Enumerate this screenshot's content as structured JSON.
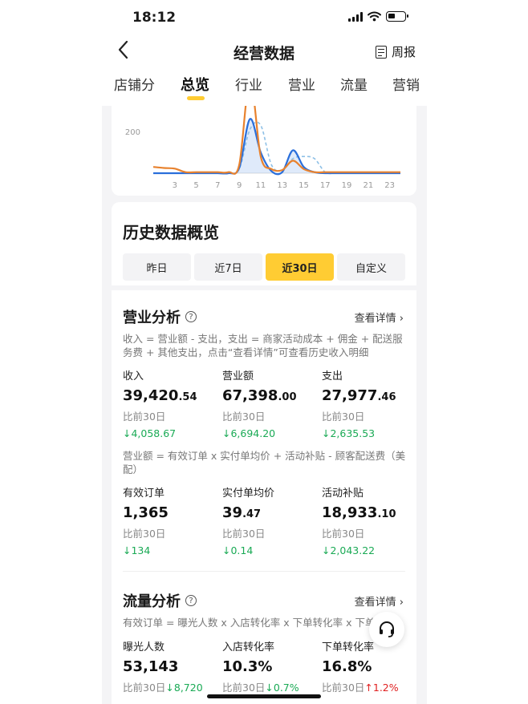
{
  "status": {
    "time": "18:12"
  },
  "nav": {
    "title": "经营数据",
    "weekly": "周报"
  },
  "tabs": [
    "店铺分",
    "总览",
    "行业",
    "营业",
    "流量",
    "营销"
  ],
  "colors": {
    "accent": "#ffcc33",
    "up": "#1aaa55",
    "down": "#e02020",
    "line_orange": "#e8822e",
    "line_blue": "#2a6fdb"
  },
  "chart_data": {
    "type": "line",
    "x_ticks": [
      "3",
      "5",
      "7",
      "9",
      "11",
      "13",
      "15",
      "17",
      "19",
      "21",
      "23"
    ],
    "y_tick": "200",
    "series": [
      {
        "values": [
          30,
          25,
          22,
          5,
          5,
          5,
          5,
          5,
          40,
          450,
          80,
          20,
          15,
          60,
          20,
          5,
          5,
          5,
          5,
          5,
          5,
          5,
          5,
          5
        ]
      },
      {
        "values": [
          0,
          0,
          0,
          0,
          0,
          0,
          0,
          0,
          25,
          260,
          100,
          10,
          5,
          110,
          30,
          5,
          0,
          0,
          0,
          0,
          0,
          0,
          0,
          0
        ]
      },
      {
        "values": [
          0,
          0,
          0,
          0,
          0,
          0,
          0,
          0,
          20,
          210,
          230,
          40,
          15,
          70,
          80,
          70,
          5,
          0,
          0,
          0,
          0,
          0,
          0,
          0
        ]
      }
    ]
  },
  "history": {
    "title": "历史数据概览",
    "ranges": [
      "昨日",
      "近7日",
      "近30日",
      "自定义"
    ],
    "business": {
      "title": "营业分析",
      "help": "?",
      "detail": "查看详情 ›",
      "formula1": "收入 = 营业额 - 支出，支出 = 商家活动成本 + 佣金 + 配送服务费 + 其他支出，点击“查看详情”可查看历史收入明细",
      "row1": [
        {
          "label": "收入",
          "int": "39,420",
          "dec": ".54",
          "cmp": "比前30日",
          "delta": "↓4,058.67"
        },
        {
          "label": "营业额",
          "int": "67,398",
          "dec": ".00",
          "cmp": "比前30日",
          "delta": "↓6,694.20"
        },
        {
          "label": "支出",
          "int": "27,977",
          "dec": ".46",
          "cmp": "比前30日",
          "delta": "↓2,635.53"
        }
      ],
      "formula2": "营业额 = 有效订单 x 实付单均价 + 活动补贴 - 顾客配送费（美配）",
      "row2": [
        {
          "label": "有效订单",
          "int": "1,365",
          "dec": "",
          "cmp": "比前30日",
          "delta": "↓134"
        },
        {
          "label": "实付单均价",
          "int": "39",
          "dec": ".47",
          "cmp": "比前30日",
          "delta": "↓0.14"
        },
        {
          "label": "活动补贴",
          "int": "18,933",
          "dec": ".10",
          "cmp": "比前30日",
          "delta": "↓2,043.22"
        }
      ]
    },
    "traffic": {
      "title": "流量分析",
      "help": "?",
      "detail": "查看详情 ›",
      "formula": "有效订单 = 曝光人数 x 入店转化率 x 下单转化率 x 下单",
      "row": [
        {
          "label": "曝光人数",
          "value": "53,143",
          "cmp": "比前30日",
          "delta": "↓8,720"
        },
        {
          "label": "入店转化率",
          "value": "10.3%",
          "cmp": "比前30日",
          "delta": "↓0.7%"
        },
        {
          "label": "下单转化率",
          "value": "16.8%",
          "cmp": "比前30日",
          "delta": "↑1.2%"
        }
      ]
    }
  }
}
